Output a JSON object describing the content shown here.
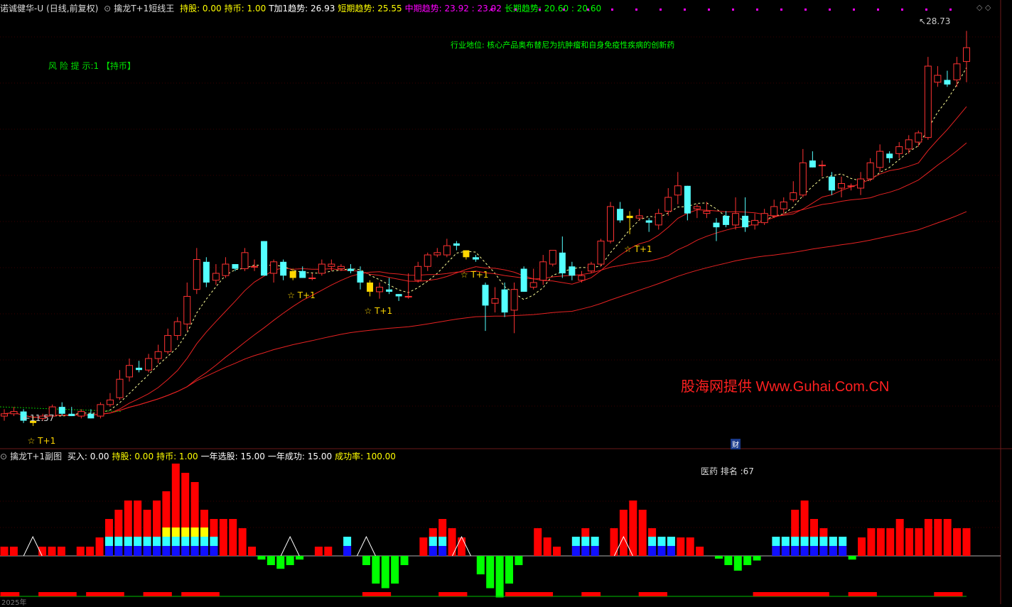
{
  "main_header": {
    "stock": "诺诚健华-U",
    "mode": "(日线,前复权)",
    "indicator_name": "擒龙T+1短线王",
    "items": [
      {
        "label": "持股:",
        "value": "0.00",
        "color": "#ffff00"
      },
      {
        "label": "持币:",
        "value": "1.00",
        "color": "#ffff00"
      },
      {
        "label": "T加1趋势:",
        "value": "26.93",
        "color": "#ffffff"
      },
      {
        "label": "短期趋势:",
        "value": "25.55",
        "color": "#ffff00"
      },
      {
        "label": "中期趋势:",
        "value": "23.92 : 23.92",
        "color": "#ff00ff"
      },
      {
        "label": "长期趋势:",
        "value": "20.60 : 20.60",
        "color": "#00ff00"
      }
    ]
  },
  "sub_header": {
    "indicator_name": "擒龙T+1副图",
    "items": [
      {
        "label": "买入:",
        "value": "0.00",
        "color": "#ffffff"
      },
      {
        "label": "持股:",
        "value": "0.00",
        "color": "#ffff00"
      },
      {
        "label": "持币:",
        "value": "1.00",
        "color": "#ffff00"
      },
      {
        "label": "一年选股:",
        "value": "15.00",
        "color": "#ffffff"
      },
      {
        "label": "一年成功:",
        "value": "15.00",
        "color": "#ffffff"
      },
      {
        "label": "成功率:",
        "value": "100.00",
        "color": "#ffff00"
      }
    ]
  },
  "annotations": {
    "risk_tip": "风 险 提 示:1 【持币】",
    "industry": "行业地位: 核心产品奥布替尼为抗肿瘤和自身免疫性疾病的创新药",
    "watermark": "股海网提供 Www.Guhai.Com.CN",
    "sector_rank": "医药 排名 :67",
    "finance_marker": "财",
    "year_label": "2025年",
    "high_label": "28.73",
    "low_label": "11.57",
    "signal_label": "☆ T+1"
  },
  "colors": {
    "up": "#ff3232",
    "down": "#54ffff",
    "signal": "#ffd700",
    "ma": "#e62222",
    "ma_dash": "#ffff99",
    "bar_red": "#ff0000",
    "bar_green": "#00ff00",
    "bar_cyan": "#33ffff",
    "bar_blue": "#1010ff",
    "bar_yellow": "#ffff00"
  },
  "chart_data": [
    {
      "type": "candlestick",
      "title": "诺诚健华-U",
      "price_range": [
        10.8,
        29.3
      ],
      "max_price": 28.73,
      "min_price": 11.57,
      "candles": [
        [
          12.0,
          12.3,
          11.8,
          12.1
        ],
        [
          12.1,
          12.4,
          12.0,
          12.2
        ],
        [
          12.2,
          12.3,
          11.7,
          11.8
        ],
        [
          11.8,
          12.0,
          11.57,
          11.7
        ],
        [
          11.9,
          12.1,
          11.8,
          12.0
        ],
        [
          12.0,
          12.5,
          11.9,
          12.4
        ],
        [
          12.4,
          12.6,
          12.0,
          12.1
        ],
        [
          12.1,
          12.4,
          12.0,
          12.0
        ],
        [
          12.0,
          12.3,
          11.9,
          12.2
        ],
        [
          12.1,
          12.3,
          11.9,
          11.9
        ],
        [
          12.0,
          12.6,
          11.9,
          12.5
        ],
        [
          12.5,
          13.0,
          12.4,
          12.7
        ],
        [
          12.8,
          14.0,
          12.7,
          13.6
        ],
        [
          13.7,
          14.5,
          13.5,
          14.2
        ],
        [
          14.1,
          14.4,
          13.9,
          14.0
        ],
        [
          14.0,
          14.7,
          13.9,
          14.5
        ],
        [
          14.5,
          15.1,
          14.3,
          14.8
        ],
        [
          14.8,
          15.8,
          14.7,
          15.5
        ],
        [
          15.5,
          16.3,
          15.3,
          16.1
        ],
        [
          16.0,
          17.8,
          15.7,
          17.2
        ],
        [
          17.5,
          19.3,
          17.3,
          18.8
        ],
        [
          18.7,
          18.9,
          17.6,
          17.8
        ],
        [
          17.9,
          18.6,
          17.7,
          18.2
        ],
        [
          18.1,
          18.9,
          18.0,
          18.6
        ],
        [
          18.6,
          18.6,
          18.3,
          18.4
        ],
        [
          18.4,
          19.3,
          18.3,
          19.1
        ],
        [
          18.5,
          18.8,
          18.3,
          18.5
        ],
        [
          19.6,
          19.6,
          18.2,
          18.1
        ],
        [
          18.2,
          18.8,
          17.8,
          18.7
        ],
        [
          18.7,
          18.8,
          17.9,
          18.1
        ],
        [
          18.0,
          18.4,
          17.9,
          18.3
        ],
        [
          18.3,
          18.5,
          18.0,
          18.0
        ],
        [
          18.0,
          18.2,
          17.9,
          18.0
        ],
        [
          18.2,
          18.8,
          18.1,
          18.6
        ],
        [
          18.5,
          18.8,
          18.3,
          18.6
        ],
        [
          18.4,
          18.6,
          18.3,
          18.5
        ],
        [
          18.4,
          18.6,
          18.2,
          18.3
        ],
        [
          18.3,
          18.5,
          17.5,
          17.8
        ],
        [
          17.8,
          17.9,
          17.2,
          17.4
        ],
        [
          17.4,
          17.8,
          17.1,
          17.6
        ],
        [
          17.5,
          18.0,
          17.3,
          17.4
        ],
        [
          17.3,
          17.3,
          17.0,
          17.2
        ],
        [
          17.2,
          18.2,
          17.1,
          17.2
        ],
        [
          17.9,
          18.7,
          17.8,
          18.5
        ],
        [
          18.5,
          19.1,
          18.3,
          19.0
        ],
        [
          19.0,
          19.3,
          18.9,
          19.1
        ],
        [
          19.0,
          19.7,
          18.9,
          19.4
        ],
        [
          19.5,
          19.6,
          19.2,
          19.4
        ],
        [
          19.2,
          19.2,
          18.8,
          18.9
        ],
        [
          18.9,
          19.0,
          18.7,
          18.8
        ],
        [
          17.7,
          17.8,
          15.7,
          16.8
        ],
        [
          16.9,
          17.6,
          16.5,
          17.1
        ],
        [
          17.5,
          17.8,
          16.3,
          16.5
        ],
        [
          16.6,
          17.8,
          15.6,
          17.5
        ],
        [
          18.4,
          18.5,
          17.4,
          17.4
        ],
        [
          17.6,
          18.4,
          17.5,
          17.8
        ],
        [
          17.9,
          19.0,
          17.7,
          18.7
        ],
        [
          18.6,
          19.2,
          18.5,
          19.2
        ],
        [
          19.1,
          19.8,
          18.0,
          18.2
        ],
        [
          18.5,
          18.7,
          17.9,
          18.1
        ],
        [
          17.9,
          18.3,
          17.8,
          18.1
        ],
        [
          18.3,
          18.7,
          18.2,
          18.6
        ],
        [
          18.6,
          19.7,
          18.5,
          19.6
        ],
        [
          19.6,
          21.3,
          19.5,
          21.1
        ],
        [
          21.0,
          21.3,
          20.4,
          20.5
        ],
        [
          20.6,
          20.9,
          19.9,
          20.7
        ],
        [
          20.6,
          21.0,
          20.5,
          20.7
        ],
        [
          20.5,
          20.6,
          20.0,
          20.4
        ],
        [
          20.3,
          21.0,
          20.1,
          20.8
        ],
        [
          20.9,
          21.9,
          20.7,
          21.5
        ],
        [
          21.6,
          22.6,
          21.2,
          22.0
        ],
        [
          22.0,
          22.0,
          20.5,
          20.8
        ],
        [
          21.0,
          21.2,
          20.6,
          21.1
        ],
        [
          20.8,
          21.3,
          20.6,
          20.9
        ],
        [
          20.4,
          20.6,
          19.6,
          20.2
        ],
        [
          20.7,
          20.9,
          20.2,
          20.3
        ],
        [
          20.3,
          21.5,
          20.1,
          20.8
        ],
        [
          20.7,
          21.5,
          20.0,
          20.2
        ],
        [
          20.3,
          20.8,
          20.1,
          20.5
        ],
        [
          20.4,
          21.0,
          20.3,
          20.8
        ],
        [
          20.7,
          21.4,
          20.6,
          21.1
        ],
        [
          21.0,
          21.5,
          20.8,
          21.3
        ],
        [
          21.4,
          22.2,
          21.3,
          21.7
        ],
        [
          21.6,
          23.6,
          21.5,
          23.0
        ],
        [
          23.1,
          23.5,
          22.8,
          22.8
        ],
        [
          22.9,
          23.1,
          22.4,
          22.9
        ],
        [
          22.4,
          22.6,
          21.6,
          21.8
        ],
        [
          21.9,
          22.4,
          21.5,
          22.1
        ],
        [
          22.0,
          22.1,
          21.8,
          22.0
        ],
        [
          21.9,
          22.6,
          21.6,
          22.3
        ],
        [
          22.3,
          23.2,
          22.2,
          23.0
        ],
        [
          22.8,
          23.8,
          22.6,
          23.5
        ],
        [
          23.4,
          23.5,
          23.0,
          23.2
        ],
        [
          23.4,
          23.9,
          23.2,
          23.7
        ],
        [
          23.6,
          24.2,
          23.4,
          24.0
        ],
        [
          23.9,
          24.4,
          23.7,
          24.3
        ],
        [
          24.1,
          27.6,
          24.0,
          27.2
        ],
        [
          26.5,
          27.2,
          26.3,
          26.8
        ],
        [
          26.6,
          27.0,
          26.3,
          26.4
        ],
        [
          26.6,
          27.6,
          26.3,
          27.3
        ],
        [
          27.4,
          28.73,
          26.5,
          28.0
        ]
      ],
      "signals_at_index": [
        3,
        30,
        38,
        48,
        65
      ]
    },
    {
      "type": "bar",
      "title": "擒龙T+1副图",
      "values": [
        1,
        1,
        0,
        0,
        1,
        1,
        1,
        0,
        1,
        1,
        2,
        4,
        5,
        6,
        6,
        5,
        6,
        7,
        10,
        9,
        8,
        5,
        4,
        4,
        4,
        3,
        1,
        -0.4,
        -1,
        -1.4,
        -1,
        -0.4,
        0,
        1,
        1,
        0,
        1,
        0,
        -1,
        -3,
        -3.5,
        -3,
        -1,
        0,
        2,
        3,
        4,
        3,
        2,
        0,
        -2,
        -3.5,
        -4.5,
        -3,
        -1,
        0,
        3,
        2,
        1,
        0,
        2,
        3,
        1,
        0,
        3,
        5,
        6,
        5,
        3,
        1,
        2,
        2,
        2,
        1,
        0,
        -0.3,
        -1,
        -1.6,
        -1,
        -0.5,
        0,
        1,
        2,
        5,
        6,
        4,
        3,
        2,
        1,
        -0.4,
        2,
        3,
        3,
        3,
        4,
        3,
        3,
        4,
        4,
        4,
        3,
        3
      ],
      "stacked_markers": [
        11,
        12,
        13,
        14,
        15,
        16,
        17,
        18,
        19,
        20,
        21,
        22,
        36,
        37,
        45,
        46,
        50,
        51,
        52,
        53,
        54,
        55,
        59,
        60,
        61,
        62,
        63,
        68,
        69,
        70,
        77,
        78,
        79,
        80,
        81,
        82,
        83,
        84,
        85,
        86,
        87,
        88,
        89
      ],
      "yellow_markers": [
        17,
        18,
        19,
        20,
        21
      ],
      "triangles_at_index": [
        3,
        30,
        38,
        48,
        65
      ],
      "bottom_red_segments": [
        [
          0,
          2
        ],
        [
          4,
          8
        ],
        [
          9,
          13
        ],
        [
          15,
          18
        ],
        [
          19,
          23
        ],
        [
          38,
          41
        ],
        [
          46,
          49
        ],
        [
          53,
          58
        ],
        [
          61,
          63
        ],
        [
          67,
          70
        ],
        [
          79,
          87
        ],
        [
          89,
          92
        ],
        [
          98,
          101
        ]
      ]
    }
  ]
}
